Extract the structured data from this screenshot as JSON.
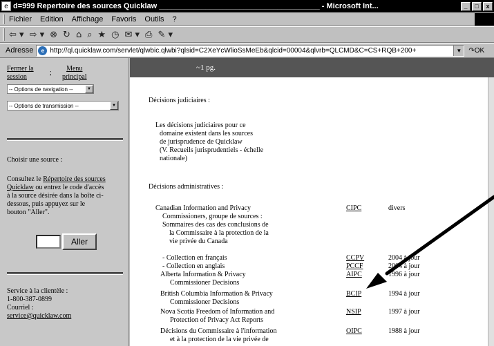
{
  "window": {
    "title": "d=999 Repertoire des sources Quicklaw",
    "app_suffix": "- Microsoft Int...",
    "minimize": "_",
    "restore": "□",
    "close": "x"
  },
  "menu": {
    "items": [
      "Fichier",
      "Edition",
      "Affichage",
      "Favoris",
      "Outils",
      "?"
    ]
  },
  "toolbar": {
    "icons": [
      "back-icon",
      "forward-icon",
      "stop-icon",
      "refresh-icon",
      "home-icon",
      "search-icon",
      "favorites-icon",
      "history-icon",
      "mail-icon",
      "print-icon",
      "edit-icon"
    ],
    "glyphs": [
      "⇦ ▾",
      "⇨ ▾",
      "⊗",
      "↻",
      "⌂",
      "⌕",
      "★",
      "◷",
      "✉ ▾",
      "⎙",
      "✎ ▾"
    ]
  },
  "address": {
    "label": "Adresse",
    "url": "http://ql.quicklaw.com/servlet/qlwbic.qlwbi?qlsid=C2XeYcWlioSsMeEb&qlcid=00004&qlvrb=QLCMD&C=CS+RQB+200+",
    "go_label": "OK"
  },
  "left": {
    "fermer_line1": "Fermer la",
    "fermer_line2": "session",
    "separator": ";",
    "menu_line1": "Menu",
    "menu_line2": "principal",
    "nav_select": "-- Options de navigation --",
    "trans_select": "-- Options de transmission --",
    "choisir": "Choisir une source :",
    "consultez_pre": "Consultez le",
    "repertoire_link_1": "Répertoire des sources",
    "repertoire_link_2": "Quicklaw",
    "consultez_post_1": "ou entrez le code d'accès",
    "consultez_line3": "à la source désirée dans la boîte ci-",
    "consultez_line4": "dessous, puis appuyez sur le",
    "consultez_line5": "bouton \"Aller\".",
    "aller_button": "Aller",
    "service_label": "Service à la clientèle :",
    "phone": "1-800-387-0899",
    "courriel_label": "Courriel :",
    "email": "service@quicklaw.com"
  },
  "right": {
    "page_indicator": "~1 pg.",
    "judiciaires_heading": "Décisions judiciaires :",
    "judiciaires_lines": [
      "Les décisions judiciaires pour ce",
      "domaine existent dans les sources",
      "de jurisprudence de Quicklaw",
      "(V. Recueils jurisprudentiels - échelle",
      "nationale)"
    ],
    "admin_heading": "Décisions administratives :",
    "rows": [
      {
        "lines": [
          "Canadian Information and Privacy",
          "Commissioners, groupe de sources :",
          "Sommaires des cas des conclusions de",
          "la Commissaire à la protection de la",
          "vie privée du Canada"
        ],
        "code": "CIPC",
        "dates": "divers"
      },
      {
        "lines": [
          "- Collection en français"
        ],
        "code": "CCPV",
        "dates": "2004 à jour"
      },
      {
        "lines": [
          "- Collection en anglais"
        ],
        "code": "PCCF",
        "dates": "2004 à jour"
      },
      {
        "lines": [
          "Alberta Information & Privacy",
          "Commissioner Decisions"
        ],
        "code": "AIPC",
        "dates": "1996 à jour"
      },
      {
        "lines": [
          "British Columbia Information & Privacy",
          "Commissioner Decisions"
        ],
        "code": "BCIP",
        "dates": "1994 à jour"
      },
      {
        "lines": [
          "Nova Scotia Freedom of Information and",
          "Protection of Privacy Act Reports"
        ],
        "code": "NSIP",
        "dates": "1997 à jour"
      },
      {
        "lines": [
          "Décisions du Commissaire à l'information",
          "et à la protection de la vie privée de"
        ],
        "code": "OIPC",
        "dates": "1988 à jour"
      }
    ]
  }
}
